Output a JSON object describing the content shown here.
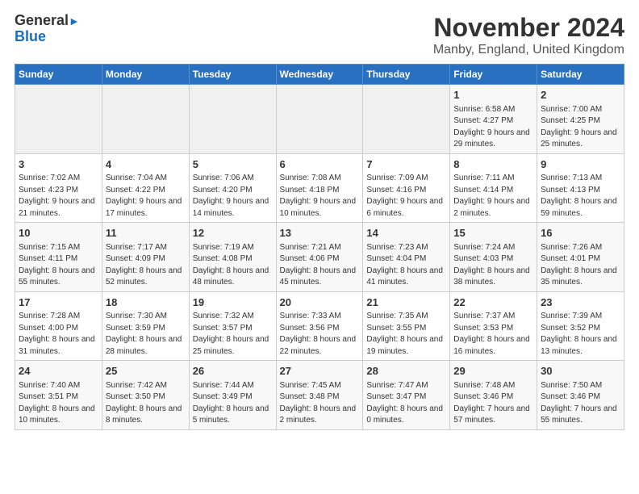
{
  "logo": {
    "line1": "General",
    "line2": "Blue"
  },
  "title": "November 2024",
  "subtitle": "Manby, England, United Kingdom",
  "days_of_week": [
    "Sunday",
    "Monday",
    "Tuesday",
    "Wednesday",
    "Thursday",
    "Friday",
    "Saturday"
  ],
  "weeks": [
    [
      {
        "day": "",
        "info": ""
      },
      {
        "day": "",
        "info": ""
      },
      {
        "day": "",
        "info": ""
      },
      {
        "day": "",
        "info": ""
      },
      {
        "day": "",
        "info": ""
      },
      {
        "day": "1",
        "info": "Sunrise: 6:58 AM\nSunset: 4:27 PM\nDaylight: 9 hours and 29 minutes."
      },
      {
        "day": "2",
        "info": "Sunrise: 7:00 AM\nSunset: 4:25 PM\nDaylight: 9 hours and 25 minutes."
      }
    ],
    [
      {
        "day": "3",
        "info": "Sunrise: 7:02 AM\nSunset: 4:23 PM\nDaylight: 9 hours and 21 minutes."
      },
      {
        "day": "4",
        "info": "Sunrise: 7:04 AM\nSunset: 4:22 PM\nDaylight: 9 hours and 17 minutes."
      },
      {
        "day": "5",
        "info": "Sunrise: 7:06 AM\nSunset: 4:20 PM\nDaylight: 9 hours and 14 minutes."
      },
      {
        "day": "6",
        "info": "Sunrise: 7:08 AM\nSunset: 4:18 PM\nDaylight: 9 hours and 10 minutes."
      },
      {
        "day": "7",
        "info": "Sunrise: 7:09 AM\nSunset: 4:16 PM\nDaylight: 9 hours and 6 minutes."
      },
      {
        "day": "8",
        "info": "Sunrise: 7:11 AM\nSunset: 4:14 PM\nDaylight: 9 hours and 2 minutes."
      },
      {
        "day": "9",
        "info": "Sunrise: 7:13 AM\nSunset: 4:13 PM\nDaylight: 8 hours and 59 minutes."
      }
    ],
    [
      {
        "day": "10",
        "info": "Sunrise: 7:15 AM\nSunset: 4:11 PM\nDaylight: 8 hours and 55 minutes."
      },
      {
        "day": "11",
        "info": "Sunrise: 7:17 AM\nSunset: 4:09 PM\nDaylight: 8 hours and 52 minutes."
      },
      {
        "day": "12",
        "info": "Sunrise: 7:19 AM\nSunset: 4:08 PM\nDaylight: 8 hours and 48 minutes."
      },
      {
        "day": "13",
        "info": "Sunrise: 7:21 AM\nSunset: 4:06 PM\nDaylight: 8 hours and 45 minutes."
      },
      {
        "day": "14",
        "info": "Sunrise: 7:23 AM\nSunset: 4:04 PM\nDaylight: 8 hours and 41 minutes."
      },
      {
        "day": "15",
        "info": "Sunrise: 7:24 AM\nSunset: 4:03 PM\nDaylight: 8 hours and 38 minutes."
      },
      {
        "day": "16",
        "info": "Sunrise: 7:26 AM\nSunset: 4:01 PM\nDaylight: 8 hours and 35 minutes."
      }
    ],
    [
      {
        "day": "17",
        "info": "Sunrise: 7:28 AM\nSunset: 4:00 PM\nDaylight: 8 hours and 31 minutes."
      },
      {
        "day": "18",
        "info": "Sunrise: 7:30 AM\nSunset: 3:59 PM\nDaylight: 8 hours and 28 minutes."
      },
      {
        "day": "19",
        "info": "Sunrise: 7:32 AM\nSunset: 3:57 PM\nDaylight: 8 hours and 25 minutes."
      },
      {
        "day": "20",
        "info": "Sunrise: 7:33 AM\nSunset: 3:56 PM\nDaylight: 8 hours and 22 minutes."
      },
      {
        "day": "21",
        "info": "Sunrise: 7:35 AM\nSunset: 3:55 PM\nDaylight: 8 hours and 19 minutes."
      },
      {
        "day": "22",
        "info": "Sunrise: 7:37 AM\nSunset: 3:53 PM\nDaylight: 8 hours and 16 minutes."
      },
      {
        "day": "23",
        "info": "Sunrise: 7:39 AM\nSunset: 3:52 PM\nDaylight: 8 hours and 13 minutes."
      }
    ],
    [
      {
        "day": "24",
        "info": "Sunrise: 7:40 AM\nSunset: 3:51 PM\nDaylight: 8 hours and 10 minutes."
      },
      {
        "day": "25",
        "info": "Sunrise: 7:42 AM\nSunset: 3:50 PM\nDaylight: 8 hours and 8 minutes."
      },
      {
        "day": "26",
        "info": "Sunrise: 7:44 AM\nSunset: 3:49 PM\nDaylight: 8 hours and 5 minutes."
      },
      {
        "day": "27",
        "info": "Sunrise: 7:45 AM\nSunset: 3:48 PM\nDaylight: 8 hours and 2 minutes."
      },
      {
        "day": "28",
        "info": "Sunrise: 7:47 AM\nSunset: 3:47 PM\nDaylight: 8 hours and 0 minutes."
      },
      {
        "day": "29",
        "info": "Sunrise: 7:48 AM\nSunset: 3:46 PM\nDaylight: 7 hours and 57 minutes."
      },
      {
        "day": "30",
        "info": "Sunrise: 7:50 AM\nSunset: 3:46 PM\nDaylight: 7 hours and 55 minutes."
      }
    ]
  ]
}
